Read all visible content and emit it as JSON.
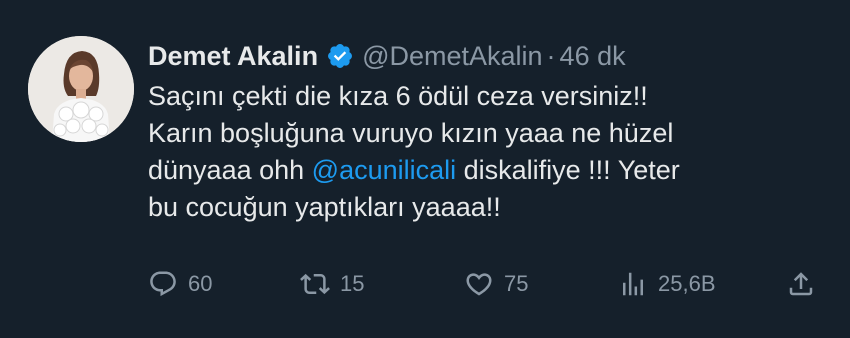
{
  "tweet": {
    "author": {
      "name": "Demet Akalin",
      "handle": "@DemetAkalin",
      "verified": true,
      "avatar_icon": "profile-photo"
    },
    "separator": "·",
    "time": "46 dk",
    "text": {
      "line1": "Saçını çekti die kıza 6 ödül ceza versiniz!!",
      "line2": "Karın boşluğuna vuruyo kızın yaaa ne hüzel",
      "line3_before": "dünyaaa ohh ",
      "line3_mention": "@acunilicali",
      "line3_after": " diskalifiye !!! Yeter",
      "line4": "bu cocuğun yaptıkları yaaaa!!"
    },
    "actions": {
      "reply": {
        "icon": "reply-icon",
        "count": "60"
      },
      "retweet": {
        "icon": "retweet-icon",
        "count": "15"
      },
      "like": {
        "icon": "heart-icon",
        "count": "75"
      },
      "views": {
        "icon": "views-icon",
        "count": "25,6B"
      },
      "share": {
        "icon": "share-icon"
      }
    }
  },
  "colors": {
    "background": "#15202b",
    "text": "#e7e9ea",
    "secondary": "#8b98a5",
    "accent": "#1d9bf0"
  }
}
